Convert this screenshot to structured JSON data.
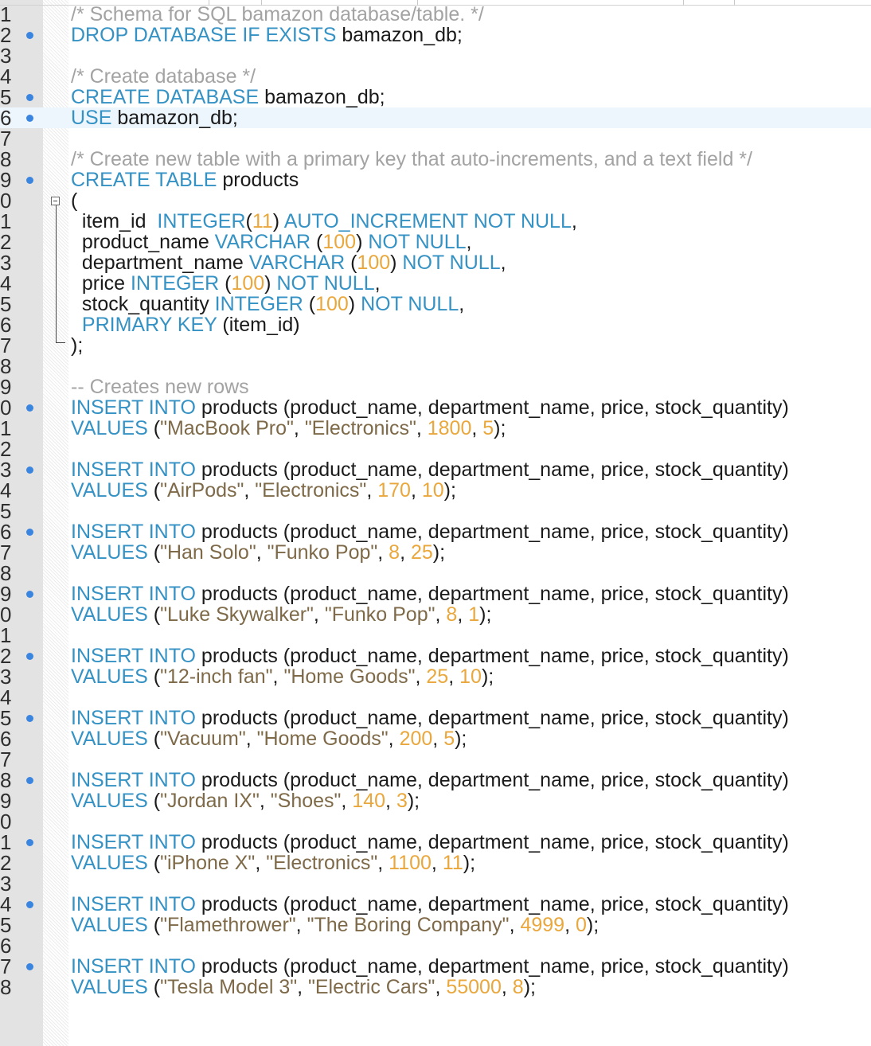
{
  "editor": {
    "lines": [
      {
        "n": "1",
        "bp": false,
        "tokens": [
          {
            "t": "/* Schema for SQL bamazon database/table. */",
            "c": "cm"
          }
        ]
      },
      {
        "n": "2",
        "bp": true,
        "tokens": [
          {
            "t": "DROP DATABASE IF EXISTS",
            "c": "kw"
          },
          {
            "t": " bamazon_db;",
            "c": "pl"
          }
        ]
      },
      {
        "n": "3",
        "bp": false,
        "tokens": []
      },
      {
        "n": "4",
        "bp": false,
        "tokens": [
          {
            "t": "/* Create database */",
            "c": "cm"
          }
        ]
      },
      {
        "n": "5",
        "bp": true,
        "tokens": [
          {
            "t": "CREATE DATABASE",
            "c": "kw"
          },
          {
            "t": " bamazon_db;",
            "c": "pl"
          }
        ]
      },
      {
        "n": "6",
        "bp": true,
        "active": true,
        "tokens": [
          {
            "t": "USE",
            "c": "kw"
          },
          {
            "t": " bamazon_db;",
            "c": "pl"
          }
        ]
      },
      {
        "n": "7",
        "bp": false,
        "tokens": []
      },
      {
        "n": "8",
        "bp": false,
        "tokens": [
          {
            "t": "/* Create new table with a primary key that auto-increments, and a text field */",
            "c": "cm"
          }
        ]
      },
      {
        "n": "9",
        "bp": true,
        "tokens": [
          {
            "t": "CREATE TABLE",
            "c": "kw"
          },
          {
            "t": " products",
            "c": "pl"
          }
        ]
      },
      {
        "n": "0",
        "bp": false,
        "tokens": [
          {
            "t": "(",
            "c": "pl"
          }
        ]
      },
      {
        "n": "1",
        "bp": false,
        "tokens": [
          {
            "t": "  item_id  ",
            "c": "pl"
          },
          {
            "t": "INTEGER",
            "c": "kw"
          },
          {
            "t": "(",
            "c": "pl"
          },
          {
            "t": "11",
            "c": "num"
          },
          {
            "t": ") ",
            "c": "pl"
          },
          {
            "t": "AUTO_INCREMENT NOT NULL",
            "c": "kw"
          },
          {
            "t": ",",
            "c": "pl"
          }
        ]
      },
      {
        "n": "2",
        "bp": false,
        "tokens": [
          {
            "t": "  product_name ",
            "c": "pl"
          },
          {
            "t": "VARCHAR",
            "c": "kw"
          },
          {
            "t": " (",
            "c": "pl"
          },
          {
            "t": "100",
            "c": "num"
          },
          {
            "t": ") ",
            "c": "pl"
          },
          {
            "t": "NOT NULL",
            "c": "kw"
          },
          {
            "t": ",",
            "c": "pl"
          }
        ]
      },
      {
        "n": "3",
        "bp": false,
        "tokens": [
          {
            "t": "  department_name ",
            "c": "pl"
          },
          {
            "t": "VARCHAR",
            "c": "kw"
          },
          {
            "t": " (",
            "c": "pl"
          },
          {
            "t": "100",
            "c": "num"
          },
          {
            "t": ") ",
            "c": "pl"
          },
          {
            "t": "NOT NULL",
            "c": "kw"
          },
          {
            "t": ",",
            "c": "pl"
          }
        ]
      },
      {
        "n": "4",
        "bp": false,
        "tokens": [
          {
            "t": "  price ",
            "c": "pl"
          },
          {
            "t": "INTEGER",
            "c": "kw"
          },
          {
            "t": " (",
            "c": "pl"
          },
          {
            "t": "100",
            "c": "num"
          },
          {
            "t": ") ",
            "c": "pl"
          },
          {
            "t": "NOT NULL",
            "c": "kw"
          },
          {
            "t": ",",
            "c": "pl"
          }
        ]
      },
      {
        "n": "5",
        "bp": false,
        "tokens": [
          {
            "t": "  stock_quantity ",
            "c": "pl"
          },
          {
            "t": "INTEGER",
            "c": "kw"
          },
          {
            "t": " (",
            "c": "pl"
          },
          {
            "t": "100",
            "c": "num"
          },
          {
            "t": ") ",
            "c": "pl"
          },
          {
            "t": "NOT NULL",
            "c": "kw"
          },
          {
            "t": ",",
            "c": "pl"
          }
        ]
      },
      {
        "n": "6",
        "bp": false,
        "tokens": [
          {
            "t": "  ",
            "c": "pl"
          },
          {
            "t": "PRIMARY KEY",
            "c": "kw"
          },
          {
            "t": " (item_id)",
            "c": "pl"
          }
        ]
      },
      {
        "n": "7",
        "bp": false,
        "tokens": [
          {
            "t": ");",
            "c": "pl"
          }
        ]
      },
      {
        "n": "8",
        "bp": false,
        "tokens": []
      },
      {
        "n": "9",
        "bp": false,
        "tokens": [
          {
            "t": "-- Creates new rows",
            "c": "cm"
          }
        ]
      },
      {
        "n": "0",
        "bp": true,
        "tokens": [
          {
            "t": "INSERT INTO",
            "c": "kw"
          },
          {
            "t": " products (product_name, department_name, price, stock_quantity)",
            "c": "pl"
          }
        ]
      },
      {
        "n": "1",
        "bp": false,
        "tokens": [
          {
            "t": "VALUES",
            "c": "kw"
          },
          {
            "t": " (",
            "c": "pl"
          },
          {
            "t": "\"MacBook Pro\"",
            "c": "str"
          },
          {
            "t": ", ",
            "c": "pl"
          },
          {
            "t": "\"Electronics\"",
            "c": "str"
          },
          {
            "t": ", ",
            "c": "pl"
          },
          {
            "t": "1800",
            "c": "num"
          },
          {
            "t": ", ",
            "c": "pl"
          },
          {
            "t": "5",
            "c": "num"
          },
          {
            "t": ");",
            "c": "pl"
          }
        ]
      },
      {
        "n": "2",
        "bp": false,
        "tokens": []
      },
      {
        "n": "3",
        "bp": true,
        "tokens": [
          {
            "t": "INSERT INTO",
            "c": "kw"
          },
          {
            "t": " products (product_name, department_name, price, stock_quantity)",
            "c": "pl"
          }
        ]
      },
      {
        "n": "4",
        "bp": false,
        "tokens": [
          {
            "t": "VALUES",
            "c": "kw"
          },
          {
            "t": " (",
            "c": "pl"
          },
          {
            "t": "\"AirPods\"",
            "c": "str"
          },
          {
            "t": ", ",
            "c": "pl"
          },
          {
            "t": "\"Electronics\"",
            "c": "str"
          },
          {
            "t": ", ",
            "c": "pl"
          },
          {
            "t": "170",
            "c": "num"
          },
          {
            "t": ", ",
            "c": "pl"
          },
          {
            "t": "10",
            "c": "num"
          },
          {
            "t": ");",
            "c": "pl"
          }
        ]
      },
      {
        "n": "5",
        "bp": false,
        "tokens": []
      },
      {
        "n": "6",
        "bp": true,
        "tokens": [
          {
            "t": "INSERT INTO",
            "c": "kw"
          },
          {
            "t": " products (product_name, department_name, price, stock_quantity)",
            "c": "pl"
          }
        ]
      },
      {
        "n": "7",
        "bp": false,
        "tokens": [
          {
            "t": "VALUES",
            "c": "kw"
          },
          {
            "t": " (",
            "c": "pl"
          },
          {
            "t": "\"Han Solo\"",
            "c": "str"
          },
          {
            "t": ", ",
            "c": "pl"
          },
          {
            "t": "\"Funko Pop\"",
            "c": "str"
          },
          {
            "t": ", ",
            "c": "pl"
          },
          {
            "t": "8",
            "c": "num"
          },
          {
            "t": ", ",
            "c": "pl"
          },
          {
            "t": "25",
            "c": "num"
          },
          {
            "t": ");",
            "c": "pl"
          }
        ]
      },
      {
        "n": "8",
        "bp": false,
        "tokens": []
      },
      {
        "n": "9",
        "bp": true,
        "tokens": [
          {
            "t": "INSERT INTO",
            "c": "kw"
          },
          {
            "t": " products (product_name, department_name, price, stock_quantity)",
            "c": "pl"
          }
        ]
      },
      {
        "n": "0",
        "bp": false,
        "tokens": [
          {
            "t": "VALUES",
            "c": "kw"
          },
          {
            "t": " (",
            "c": "pl"
          },
          {
            "t": "\"Luke Skywalker\"",
            "c": "str"
          },
          {
            "t": ", ",
            "c": "pl"
          },
          {
            "t": "\"Funko Pop\"",
            "c": "str"
          },
          {
            "t": ", ",
            "c": "pl"
          },
          {
            "t": "8",
            "c": "num"
          },
          {
            "t": ", ",
            "c": "pl"
          },
          {
            "t": "1",
            "c": "num"
          },
          {
            "t": ");",
            "c": "pl"
          }
        ]
      },
      {
        "n": "1",
        "bp": false,
        "tokens": []
      },
      {
        "n": "2",
        "bp": true,
        "tokens": [
          {
            "t": "INSERT INTO",
            "c": "kw"
          },
          {
            "t": " products (product_name, department_name, price, stock_quantity)",
            "c": "pl"
          }
        ]
      },
      {
        "n": "3",
        "bp": false,
        "tokens": [
          {
            "t": "VALUES",
            "c": "kw"
          },
          {
            "t": " (",
            "c": "pl"
          },
          {
            "t": "\"12-inch fan\"",
            "c": "str"
          },
          {
            "t": ", ",
            "c": "pl"
          },
          {
            "t": "\"Home Goods\"",
            "c": "str"
          },
          {
            "t": ", ",
            "c": "pl"
          },
          {
            "t": "25",
            "c": "num"
          },
          {
            "t": ", ",
            "c": "pl"
          },
          {
            "t": "10",
            "c": "num"
          },
          {
            "t": ");",
            "c": "pl"
          }
        ]
      },
      {
        "n": "4",
        "bp": false,
        "tokens": []
      },
      {
        "n": "5",
        "bp": true,
        "tokens": [
          {
            "t": "INSERT INTO",
            "c": "kw"
          },
          {
            "t": " products (product_name, department_name, price, stock_quantity)",
            "c": "pl"
          }
        ]
      },
      {
        "n": "6",
        "bp": false,
        "tokens": [
          {
            "t": "VALUES",
            "c": "kw"
          },
          {
            "t": " (",
            "c": "pl"
          },
          {
            "t": "\"Vacuum\"",
            "c": "str"
          },
          {
            "t": ", ",
            "c": "pl"
          },
          {
            "t": "\"Home Goods\"",
            "c": "str"
          },
          {
            "t": ", ",
            "c": "pl"
          },
          {
            "t": "200",
            "c": "num"
          },
          {
            "t": ", ",
            "c": "pl"
          },
          {
            "t": "5",
            "c": "num"
          },
          {
            "t": ");",
            "c": "pl"
          }
        ]
      },
      {
        "n": "7",
        "bp": false,
        "tokens": []
      },
      {
        "n": "8",
        "bp": true,
        "tokens": [
          {
            "t": "INSERT INTO",
            "c": "kw"
          },
          {
            "t": " products (product_name, department_name, price, stock_quantity)",
            "c": "pl"
          }
        ]
      },
      {
        "n": "9",
        "bp": false,
        "tokens": [
          {
            "t": "VALUES",
            "c": "kw"
          },
          {
            "t": " (",
            "c": "pl"
          },
          {
            "t": "\"Jordan IX\"",
            "c": "str"
          },
          {
            "t": ", ",
            "c": "pl"
          },
          {
            "t": "\"Shoes\"",
            "c": "str"
          },
          {
            "t": ", ",
            "c": "pl"
          },
          {
            "t": "140",
            "c": "num"
          },
          {
            "t": ", ",
            "c": "pl"
          },
          {
            "t": "3",
            "c": "num"
          },
          {
            "t": ");",
            "c": "pl"
          }
        ]
      },
      {
        "n": "0",
        "bp": false,
        "tokens": []
      },
      {
        "n": "1",
        "bp": true,
        "tokens": [
          {
            "t": "INSERT INTO",
            "c": "kw"
          },
          {
            "t": " products (product_name, department_name, price, stock_quantity)",
            "c": "pl"
          }
        ]
      },
      {
        "n": "2",
        "bp": false,
        "tokens": [
          {
            "t": "VALUES",
            "c": "kw"
          },
          {
            "t": " (",
            "c": "pl"
          },
          {
            "t": "\"iPhone X\"",
            "c": "str"
          },
          {
            "t": ", ",
            "c": "pl"
          },
          {
            "t": "\"Electronics\"",
            "c": "str"
          },
          {
            "t": ", ",
            "c": "pl"
          },
          {
            "t": "1100",
            "c": "num"
          },
          {
            "t": ", ",
            "c": "pl"
          },
          {
            "t": "11",
            "c": "num"
          },
          {
            "t": ");",
            "c": "pl"
          }
        ]
      },
      {
        "n": "3",
        "bp": false,
        "tokens": []
      },
      {
        "n": "4",
        "bp": true,
        "tokens": [
          {
            "t": "INSERT INTO",
            "c": "kw"
          },
          {
            "t": " products (product_name, department_name, price, stock_quantity)",
            "c": "pl"
          }
        ]
      },
      {
        "n": "5",
        "bp": false,
        "tokens": [
          {
            "t": "VALUES",
            "c": "kw"
          },
          {
            "t": " (",
            "c": "pl"
          },
          {
            "t": "\"Flamethrower\"",
            "c": "str"
          },
          {
            "t": ", ",
            "c": "pl"
          },
          {
            "t": "\"The Boring Company\"",
            "c": "str"
          },
          {
            "t": ", ",
            "c": "pl"
          },
          {
            "t": "4999",
            "c": "num"
          },
          {
            "t": ", ",
            "c": "pl"
          },
          {
            "t": "0",
            "c": "num"
          },
          {
            "t": ");",
            "c": "pl"
          }
        ]
      },
      {
        "n": "6",
        "bp": false,
        "tokens": []
      },
      {
        "n": "7",
        "bp": true,
        "tokens": [
          {
            "t": "INSERT INTO",
            "c": "kw"
          },
          {
            "t": " products (product_name, department_name, price, stock_quantity)",
            "c": "pl"
          }
        ]
      },
      {
        "n": "8",
        "bp": false,
        "tokens": [
          {
            "t": "VALUES",
            "c": "kw"
          },
          {
            "t": " (",
            "c": "pl"
          },
          {
            "t": "\"Tesla Model 3\"",
            "c": "str"
          },
          {
            "t": ", ",
            "c": "pl"
          },
          {
            "t": "\"Electric Cars\"",
            "c": "str"
          },
          {
            "t": ", ",
            "c": "pl"
          },
          {
            "t": "55000",
            "c": "num"
          },
          {
            "t": ", ",
            "c": "pl"
          },
          {
            "t": "8",
            "c": "num"
          },
          {
            "t": ");",
            "c": "pl"
          }
        ]
      }
    ]
  }
}
